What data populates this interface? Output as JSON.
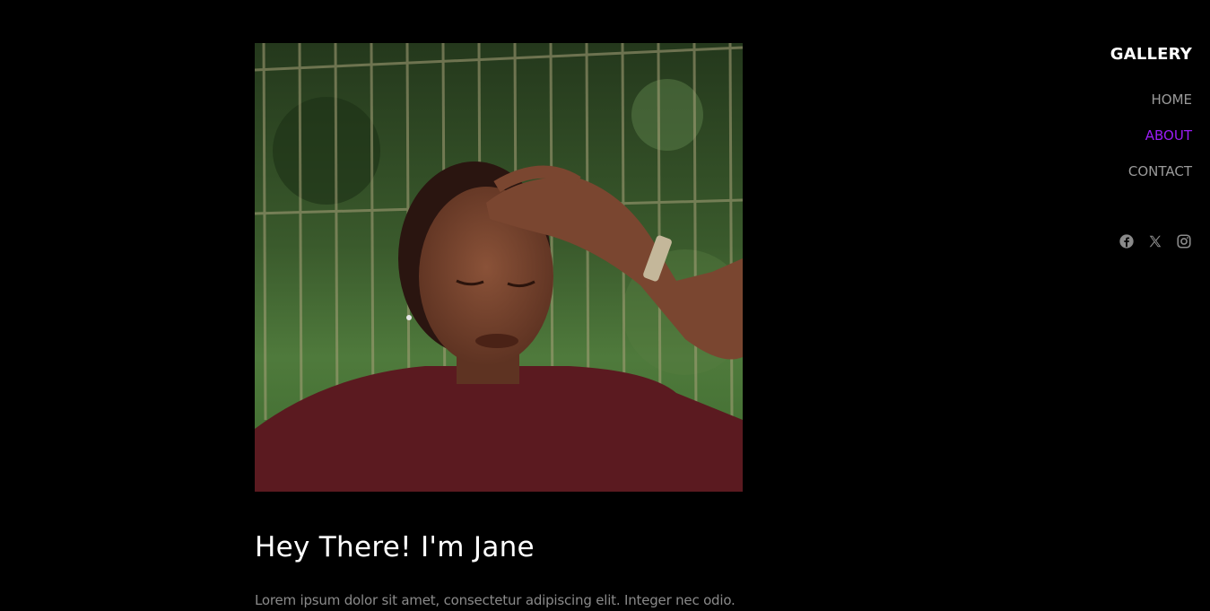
{
  "brand": "GALLERY",
  "nav": {
    "items": [
      {
        "label": "HOME",
        "active": false
      },
      {
        "label": "ABOUT",
        "active": true
      },
      {
        "label": "CONTACT",
        "active": false
      }
    ]
  },
  "social": [
    "facebook-icon",
    "x-icon",
    "instagram-icon"
  ],
  "hero": {
    "heading": "Hey There! I'm Jane",
    "text": "Lorem ipsum dolor sit amet, consectetur adipiscing elit. Integer nec odio."
  },
  "colors": {
    "background": "#000000",
    "accent": "#9b1cf5",
    "nav_text": "#9a9a9a",
    "body_text": "#8a8a8a"
  }
}
